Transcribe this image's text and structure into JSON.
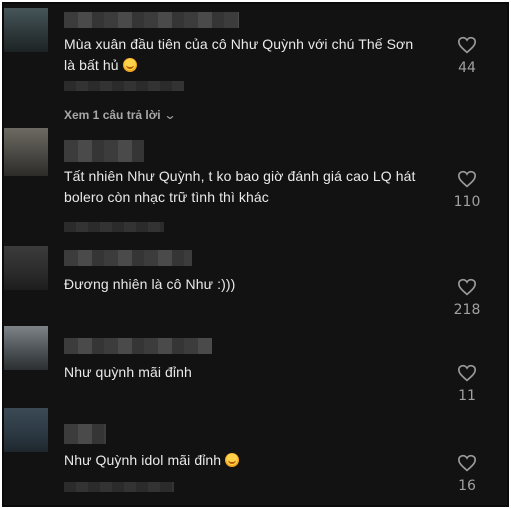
{
  "comments": [
    {
      "text": "Mùa xuân đầu tiên của cô Như Quỳnh với chú Thế Sơn là bất hủ",
      "has_emoji": true,
      "likes": "44",
      "replies_label": "Xem 1 câu trả lời"
    },
    {
      "text": "Tất nhiên Như Quỳnh, t ko bao giờ đánh giá cao LQ hát bolero còn nhạc trữ tình thì khác",
      "has_emoji": false,
      "likes": "110"
    },
    {
      "text": "Đương nhiên là cô Như :)))",
      "has_emoji": false,
      "likes": "218"
    },
    {
      "text": "Như quỳnh mãi đỉnh",
      "has_emoji": false,
      "likes": "11"
    },
    {
      "text": "Như Quỳnh idol mãi đỉnh",
      "has_emoji": true,
      "likes": "16"
    }
  ],
  "icons": {
    "like": "heart-outline-icon",
    "emoji": "smiling-face-hearts-emoji",
    "chevron": "chevron-down-icon"
  },
  "colors": {
    "background": "#121212",
    "text": "#eaeaea",
    "muted": "#9a9a9a"
  }
}
